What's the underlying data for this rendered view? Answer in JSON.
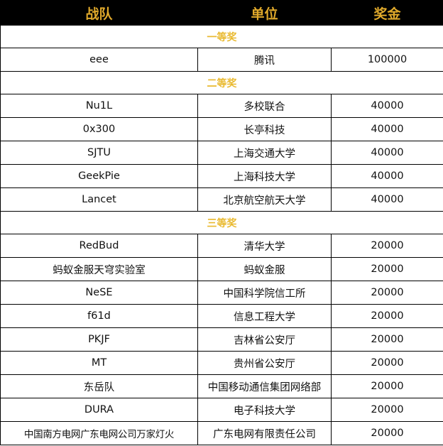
{
  "headers": [
    "战队",
    "单位",
    "奖金"
  ],
  "sections": [
    {
      "title": "一等奖",
      "rows": [
        {
          "team": "eee",
          "unit": "腾讯",
          "prize": "100000"
        }
      ]
    },
    {
      "title": "二等奖",
      "rows": [
        {
          "team": "Nu1L",
          "unit": "多校联合",
          "prize": "40000"
        },
        {
          "team": "0x300",
          "unit": "长亭科技",
          "prize": "40000"
        },
        {
          "team": "SJTU",
          "unit": "上海交通大学",
          "prize": "40000"
        },
        {
          "team": "GeekPie",
          "unit": "上海科技大学",
          "prize": "40000"
        },
        {
          "team": "Lancet",
          "unit": "北京航空航天大学",
          "prize": "40000"
        }
      ]
    },
    {
      "title": "三等奖",
      "rows": [
        {
          "team": "RedBud",
          "unit": "清华大学",
          "prize": "20000"
        },
        {
          "team": "蚂蚁金服天穹实验室",
          "unit": "蚂蚁金服",
          "prize": "20000"
        },
        {
          "team": "NeSE",
          "unit": "中国科学院信工所",
          "prize": "20000"
        },
        {
          "team": "f61d",
          "unit": "信息工程大学",
          "prize": "20000"
        },
        {
          "team": "PKJF",
          "unit": "吉林省公安厅",
          "prize": "20000"
        },
        {
          "team": "MT",
          "unit": "贵州省公安厅",
          "prize": "20000"
        },
        {
          "team": "东岳队",
          "unit": "中国移动通信集团网络部",
          "prize": "20000"
        },
        {
          "team": "DURA",
          "unit": "电子科技大学",
          "prize": "20000"
        },
        {
          "team": "中国南方电网广东电网公司万家灯火",
          "unit": "广东电网有限责任公司",
          "prize": "20000"
        }
      ]
    }
  ]
}
